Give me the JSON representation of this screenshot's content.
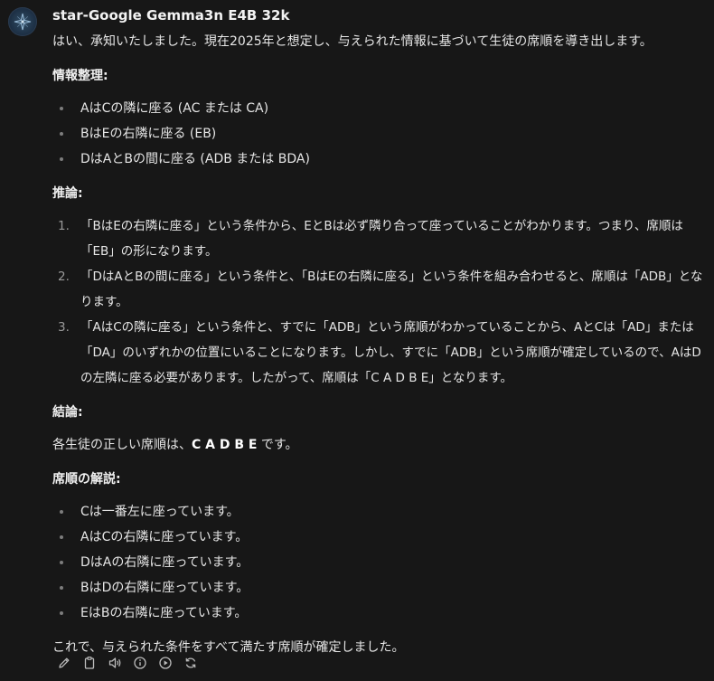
{
  "message": {
    "model_name": "star-Google Gemma3n E4B 32k",
    "intro": "はい、承知いたしました。現在2025年と想定し、与えられた情報に基づいて生徒の席順を導き出します。",
    "section_info": {
      "heading": "情報整理:",
      "items": [
        "AはCの隣に座る (AC または CA)",
        "BはEの右隣に座る (EB)",
        "DはAとBの間に座る (ADB または BDA)"
      ]
    },
    "section_reasoning": {
      "heading": "推論:",
      "items": [
        {
          "num": "1.",
          "text": "「BはEの右隣に座る」という条件から、EとBは必ず隣り合って座っていることがわかります。つまり、席順は「EB」の形になります。"
        },
        {
          "num": "2.",
          "text": "「DはAとBの間に座る」という条件と、「BはEの右隣に座る」という条件を組み合わせると、席順は「ADB」となります。"
        },
        {
          "num": "3.",
          "text": "「AはCの隣に座る」という条件と、すでに「ADB」という席順がわかっていることから、AとCは「AD」または「DA」のいずれかの位置にいることになります。しかし、すでに「ADB」という席順が確定しているので、AはDの左隣に座る必要があります。したがって、席順は「C A D B E」となります。"
        }
      ]
    },
    "section_conclusion": {
      "heading": "結論:",
      "prefix": "各生徒の正しい席順は、",
      "answer": "C A D B E",
      "suffix": " です。"
    },
    "section_explanation": {
      "heading": "席順の解説:",
      "items": [
        "Cは一番左に座っています。",
        "AはCの右隣に座っています。",
        "DはAの右隣に座っています。",
        "BはDの右隣に座っています。",
        "EはBの右隣に座っています。"
      ]
    },
    "closing": "これで、与えられた条件をすべて満たす席順が確定しました。"
  },
  "actions": [
    {
      "name": "edit",
      "icon": "pencil-icon"
    },
    {
      "name": "copy",
      "icon": "clipboard-icon"
    },
    {
      "name": "read-aloud",
      "icon": "speaker-icon"
    },
    {
      "name": "info",
      "icon": "info-icon"
    },
    {
      "name": "continue",
      "icon": "play-icon"
    },
    {
      "name": "regenerate",
      "icon": "refresh-icon"
    }
  ]
}
